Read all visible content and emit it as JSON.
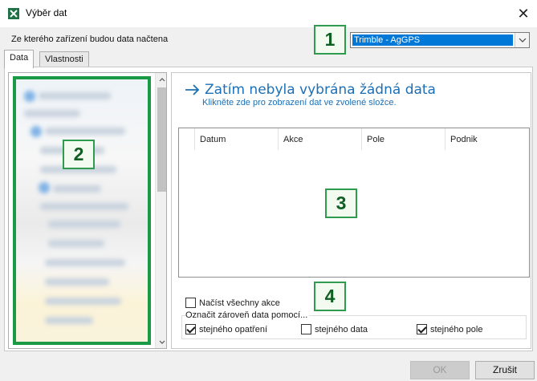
{
  "window": {
    "title": "Výběr dat"
  },
  "device": {
    "label": "Ze kterého zařízení budou data načtena",
    "selected": "Trimble - AgGPS"
  },
  "tabs": [
    {
      "label": "Data"
    },
    {
      "label": "Vlastnosti"
    }
  ],
  "data_view": {
    "title": "Zatím nebyla vybrána žádná data",
    "hint": "Klikněte zde pro zobrazení dat ve zvolené složce.",
    "columns": [
      "Datum",
      "Akce",
      "Pole",
      "Podnik"
    ]
  },
  "options": {
    "load_all_label": "Načíst všechny akce",
    "load_all_checked": false,
    "mark_label": "Označit zároveň data pomocí...",
    "mark_items": [
      {
        "label": "stejného opatření",
        "checked": true
      },
      {
        "label": "stejného data",
        "checked": false
      },
      {
        "label": "stejného pole",
        "checked": true
      }
    ]
  },
  "buttons": {
    "ok": "OK",
    "cancel": "Zrušit"
  },
  "callouts": [
    "1",
    "2",
    "3",
    "4"
  ],
  "colors": {
    "accent": "#1c6fb5",
    "callout_border": "#2e9b4e",
    "tree_highlight": "#1a9a45",
    "selection": "#0078d7"
  }
}
